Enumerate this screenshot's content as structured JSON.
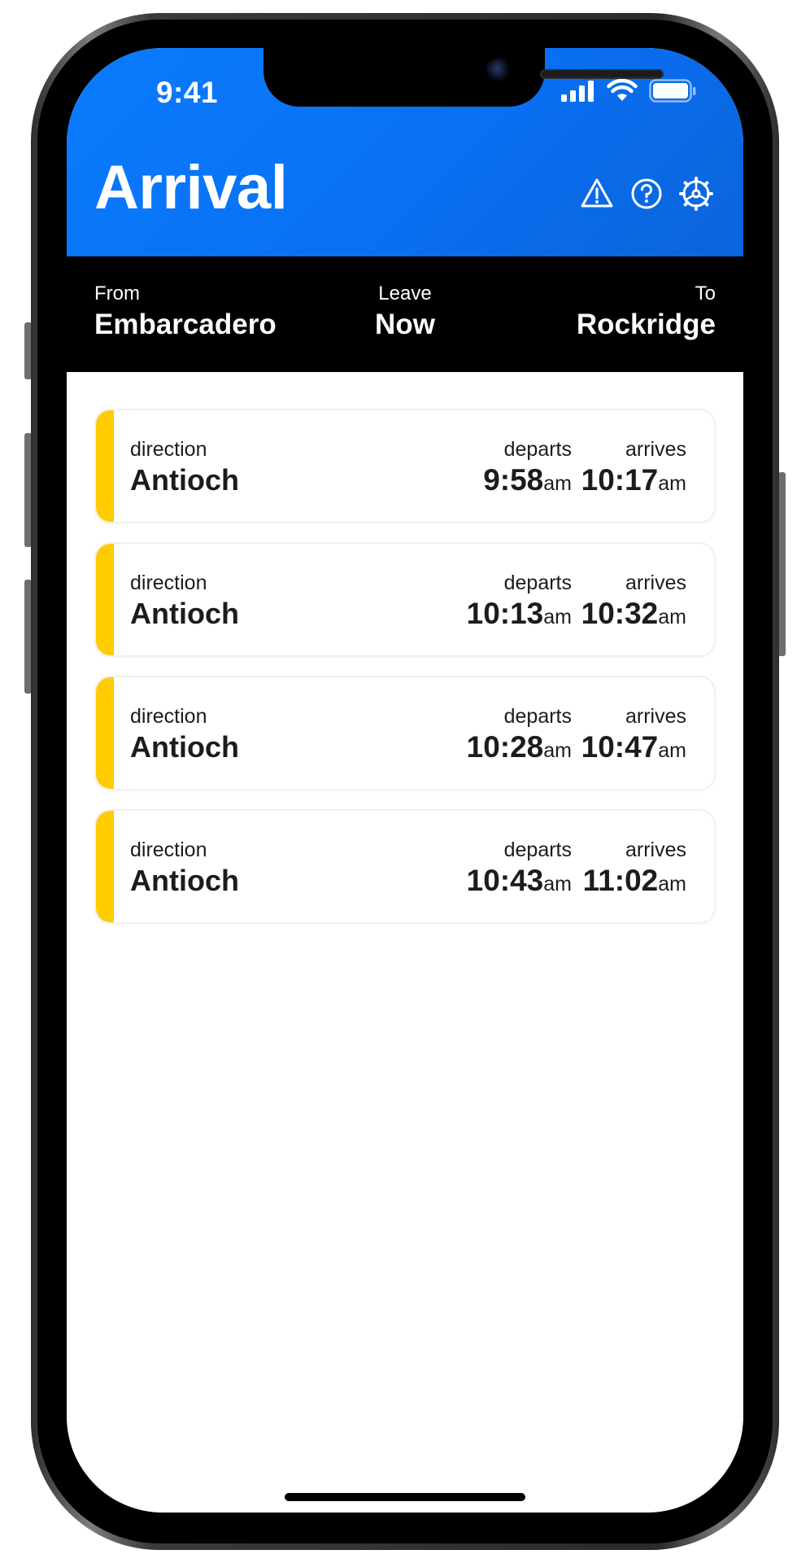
{
  "status_bar": {
    "time": "9:41",
    "icons": [
      "cellular-signal-icon",
      "wifi-icon",
      "battery-icon"
    ]
  },
  "header": {
    "title": "Arrival",
    "actions": [
      "alert-icon",
      "help-icon",
      "settings-icon"
    ],
    "background": "#0a72f5"
  },
  "route": {
    "from_label": "From",
    "from_value": "Embarcadero",
    "leave_label": "Leave",
    "leave_value": "Now",
    "to_label": "To",
    "to_value": "Rockridge"
  },
  "trips": [
    {
      "direction_label": "direction",
      "direction": "Antioch",
      "departs_label": "departs",
      "departs": "9:58",
      "departs_suffix": "am",
      "arrives_label": "arrives",
      "arrives": "10:17",
      "arrives_suffix": "am",
      "line_color": "#ffcc00"
    },
    {
      "direction_label": "direction",
      "direction": "Antioch",
      "departs_label": "departs",
      "departs": "10:13",
      "departs_suffix": "am",
      "arrives_label": "arrives",
      "arrives": "10:32",
      "arrives_suffix": "am",
      "line_color": "#ffcc00"
    },
    {
      "direction_label": "direction",
      "direction": "Antioch",
      "departs_label": "departs",
      "departs": "10:28",
      "departs_suffix": "am",
      "arrives_label": "arrives",
      "arrives": "10:47",
      "arrives_suffix": "am",
      "line_color": "#ffcc00"
    },
    {
      "direction_label": "direction",
      "direction": "Antioch",
      "departs_label": "departs",
      "departs": "10:43",
      "departs_suffix": "am",
      "arrives_label": "arrives",
      "arrives": "11:02",
      "arrives_suffix": "am",
      "line_color": "#ffcc00"
    }
  ]
}
